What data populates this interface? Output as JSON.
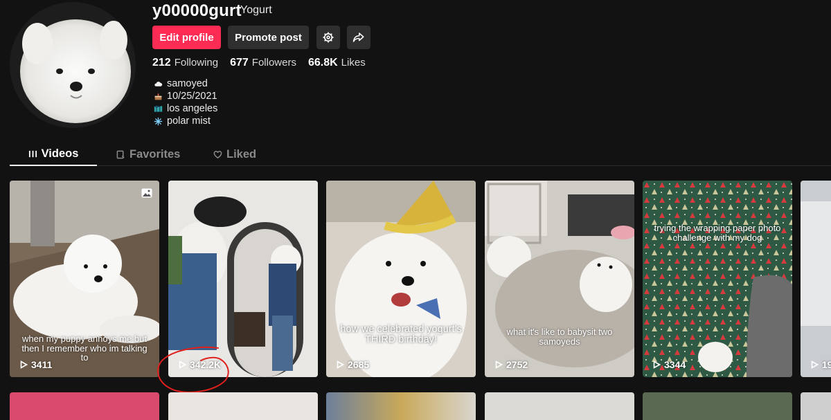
{
  "profile": {
    "username": "y00000gurt",
    "nickname": "Yogurt",
    "buttons": {
      "edit": "Edit profile",
      "promote": "Promote post"
    },
    "stats": [
      {
        "value": "212",
        "label": "Following"
      },
      {
        "value": "677",
        "label": "Followers"
      },
      {
        "value": "66.8K",
        "label": "Likes"
      }
    ],
    "bio": [
      {
        "icon": "cloud-icon",
        "text": "samoyed"
      },
      {
        "icon": "cake-icon",
        "text": "10/25/2021"
      },
      {
        "icon": "map-icon",
        "text": "los angeles"
      },
      {
        "icon": "snowflake-icon",
        "text": "polar mist"
      }
    ]
  },
  "tabs": [
    {
      "label": "Videos",
      "icon": "grid-icon",
      "active": true
    },
    {
      "label": "Favorites",
      "icon": "bookmark-icon",
      "active": false
    },
    {
      "label": "Liked",
      "icon": "heart-icon",
      "active": false
    }
  ],
  "videos": [
    {
      "views": "3411",
      "caption": "when my puppy annoys me but then I remember who im talking to",
      "photo": true
    },
    {
      "views": "342.2K",
      "caption": "",
      "photo": false,
      "highlighted": true
    },
    {
      "views": "2685",
      "caption": "how we celebrated yogurt's THIRD birthday!",
      "photo": false
    },
    {
      "views": "2752",
      "caption": "what it's like to babysit two samoyeds",
      "photo": false
    },
    {
      "views": "3344",
      "caption": "trying the wrapping paper photo challenge with my dog",
      "photo": false
    },
    {
      "views": "19",
      "caption": "",
      "photo": false
    }
  ],
  "colors": {
    "accent": "#fe2c55",
    "background": "#121212",
    "button": "#2f2f2f",
    "annotation": "#e0201c"
  }
}
